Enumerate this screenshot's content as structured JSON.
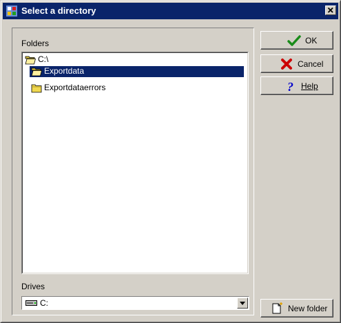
{
  "window": {
    "title": "Select a directory",
    "icons": {
      "app": "app-icon",
      "close": "close-icon"
    }
  },
  "folders": {
    "label": "Folders",
    "items": [
      {
        "label": "C:\\",
        "icon": "open-folder-icon",
        "level": 0,
        "selected": false
      },
      {
        "label": "Exportdata",
        "icon": "open-folder-icon",
        "level": 1,
        "selected": true
      },
      {
        "label": "Exportdataerrors",
        "icon": "folder-icon",
        "level": 1,
        "selected": false
      }
    ]
  },
  "drives": {
    "label": "Drives",
    "selected": "C:",
    "icon": "drive-icon"
  },
  "buttons": {
    "ok": {
      "label": "OK",
      "icon": "checkmark-icon",
      "color": "#1a8c1a"
    },
    "cancel": {
      "label": "Cancel",
      "icon": "cancel-x-icon",
      "color": "#cc0000"
    },
    "help": {
      "label": "Help",
      "icon": "help-question-icon",
      "color": "#0000cc"
    },
    "new_folder": {
      "label": "New folder",
      "icon": "new-folder-icon"
    }
  },
  "colors": {
    "titlebar": "#0a246a",
    "selection": "#0a246a",
    "face": "#d4d0c8"
  }
}
